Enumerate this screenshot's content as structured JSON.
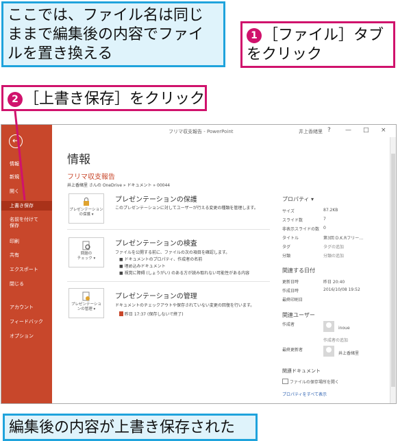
{
  "callouts": {
    "top_left": "ここでは、ファイル名は同じ\nままで編集後の内容でファイ\nルを置き換える",
    "step1_num": "1",
    "step1": "［ファイル］タブ\nをクリック",
    "step2_num": "2",
    "step2": "［上書き保存］をクリック",
    "bottom": "編集後の内容が上書き保存された"
  },
  "window": {
    "title": "フリマ収支報告 - PowerPoint",
    "user": "井上香緒里",
    "help": "?",
    "minimize": "—",
    "restore": "□",
    "close": "×"
  },
  "sidebar": {
    "back": "←",
    "items": [
      "情報",
      "新規",
      "開く",
      "上書き保存",
      "名前を付けて\n保存",
      "印刷",
      "共有",
      "エクスポート",
      "閉じる",
      "アカウント",
      "フィードバック",
      "オプション"
    ]
  },
  "main": {
    "heading": "情報",
    "file_name": "フリマ収支報告",
    "file_path": "井上香緒里 さんの OneDrive » ドキュメント » 00044",
    "sections": [
      {
        "button": "プレゼンテーション\nの保護 ▾",
        "title": "プレゼンテーションの保護",
        "desc": "このプレゼンテーションに対してユーザーが行える変更の種類を管理します。",
        "bullets": []
      },
      {
        "button": "問題の\nチェック ▾",
        "title": "プレゼンテーションの検査",
        "desc": "ファイルを公開する前に、ファイルの次の項目を確認します。",
        "bullets": [
          "ドキュメントのプロパティ、作成者の名前",
          "埋め込みドキュメント",
          "視覚に障碍 (しょうがい) のある方が読み取れない可能性がある内容"
        ]
      },
      {
        "button": "プレゼンテーショ\nンの管理 ▾",
        "title": "プレゼンテーションの管理",
        "desc": "ドキュメントのチェックアウトや保存されていない変更の回復を行います。",
        "bullets": []
      }
    ],
    "autosave": "昨日 17:37 (保存しないで終了)"
  },
  "props": {
    "header": "プロパティ ▾",
    "rows": [
      {
        "label": "サイズ",
        "value": "87.2KB"
      },
      {
        "label": "スライド数",
        "value": "7"
      },
      {
        "label": "非表示スライドの数",
        "value": "0"
      },
      {
        "label": "タイトル",
        "value": "第3回 D.K.Rフリー…"
      },
      {
        "label": "タグ",
        "value": "タグの追加"
      },
      {
        "label": "分類",
        "value": "分類の追加"
      }
    ],
    "dates_header": "関連する日付",
    "dates": [
      {
        "label": "更新日時",
        "value": "昨日 20:40"
      },
      {
        "label": "作成日時",
        "value": "2016/10/08 19:52"
      },
      {
        "label": "最終印刷日",
        "value": ""
      }
    ],
    "users_header": "関連ユーザー",
    "author_label": "作成者",
    "author": "inoue",
    "add_author": "作成者の追加",
    "modified_label": "最終更新者",
    "modified_by": "井上香緒里",
    "docs_header": "関連ドキュメント",
    "open_location": "ファイルの保存場所を開く",
    "show_all": "プロパティをすべて表示"
  },
  "colors": {
    "accent": "#c8472b",
    "callout_blue": "#1fa3dc",
    "callout_magenta": "#d0126c"
  }
}
